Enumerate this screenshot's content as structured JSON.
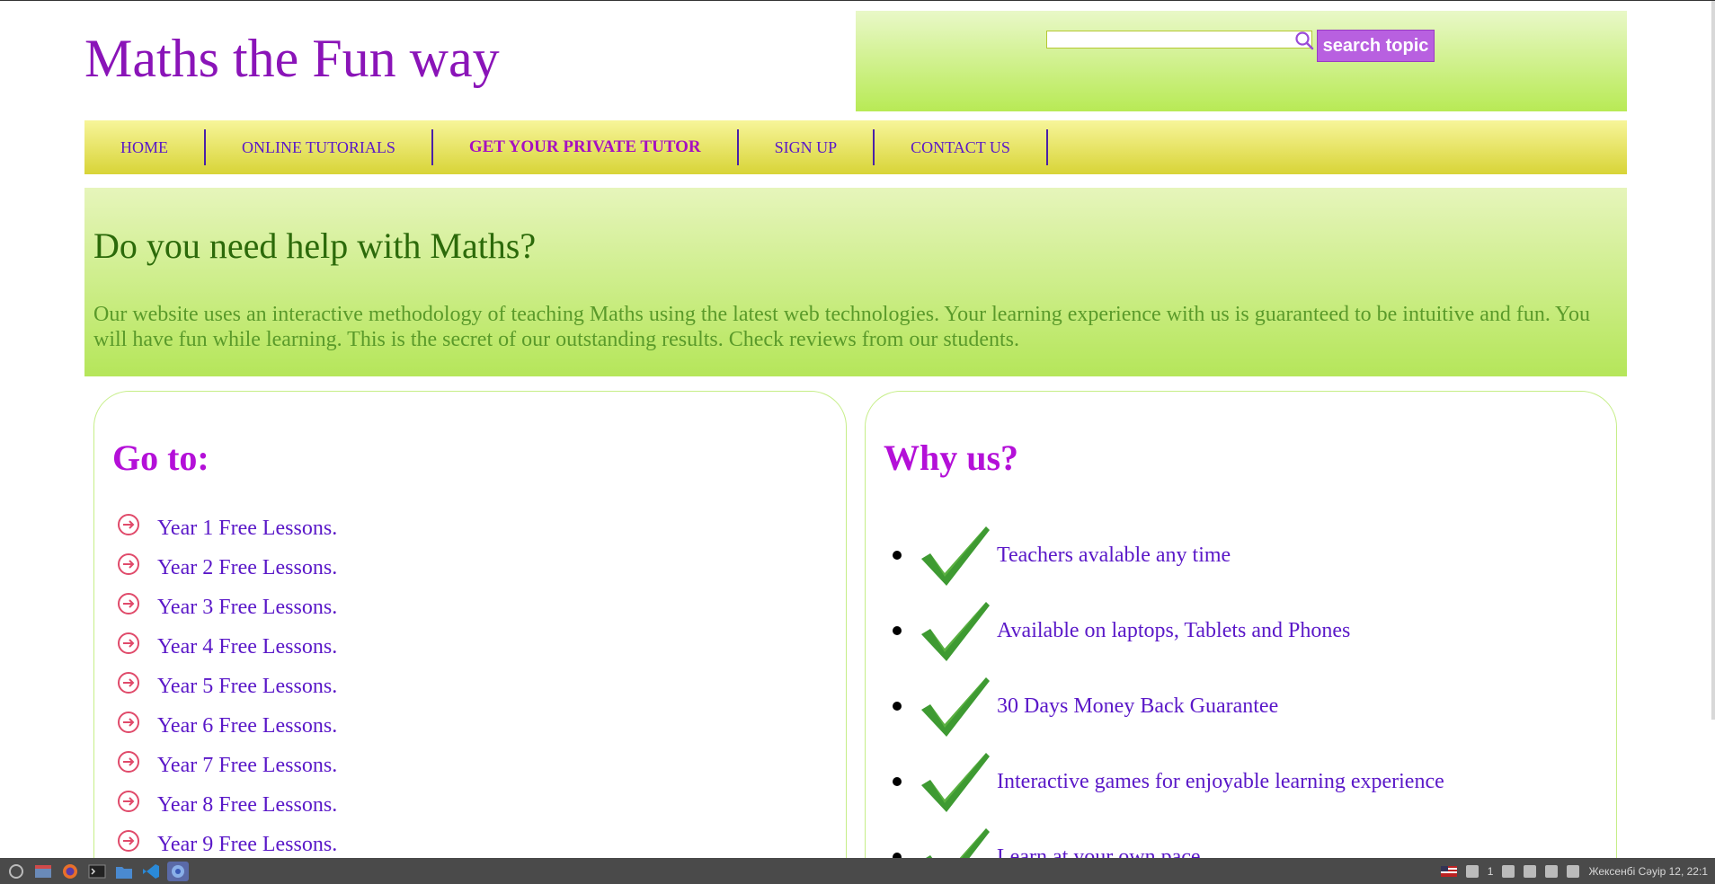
{
  "header": {
    "title": "Maths the Fun way",
    "search_placeholder": "",
    "search_button": "search topic"
  },
  "nav": {
    "items": [
      {
        "label": "HOME"
      },
      {
        "label": "ONLINE TUTORIALS"
      },
      {
        "label": "GET YOUR PRIVATE TUTOR"
      },
      {
        "label": "SIGN UP"
      },
      {
        "label": "CONTACT US"
      }
    ]
  },
  "banner": {
    "heading": "Do you need help with Maths?",
    "text": "Our website uses an interactive methodology of teaching Maths using the latest web technologies. Your learning experience with us is guaranteed to be intuitive and fun. You will have fun while learning. This is the secret of our outstanding results. Check reviews from our students."
  },
  "goto": {
    "heading": "Go to:",
    "items": [
      {
        "label": "Year 1 Free Lessons."
      },
      {
        "label": "Year 2 Free Lessons."
      },
      {
        "label": "Year 3 Free Lessons."
      },
      {
        "label": "Year 4 Free Lessons."
      },
      {
        "label": "Year 5 Free Lessons."
      },
      {
        "label": "Year 6 Free Lessons."
      },
      {
        "label": "Year 7 Free Lessons."
      },
      {
        "label": "Year 8 Free Lessons."
      },
      {
        "label": "Year 9 Free Lessons."
      }
    ]
  },
  "why": {
    "heading": "Why us?",
    "items": [
      {
        "label": "Teachers avalable any time"
      },
      {
        "label": "Available on laptops, Tablets and Phones"
      },
      {
        "label": "30 Days Money Back Guarantee"
      },
      {
        "label": "Interactive games for enjoyable learning experience"
      },
      {
        "label": "Learn at your own pace"
      }
    ]
  },
  "taskbar": {
    "clock": "Жексенбі Сәуір 12, 22:1",
    "workspace": "1",
    "apps": [
      "menu-icon",
      "files-icon",
      "firefox-icon",
      "terminal-icon",
      "folder-icon",
      "vscode-icon",
      "chromium-icon"
    ]
  },
  "colors": {
    "title": "#8a14b8",
    "nav_text": "#5a18c8",
    "heading_purple": "#b410d8",
    "banner_heading": "#2c6a0a",
    "banner_text": "#5a9a2a",
    "search_button_bg": "#b860e0"
  }
}
